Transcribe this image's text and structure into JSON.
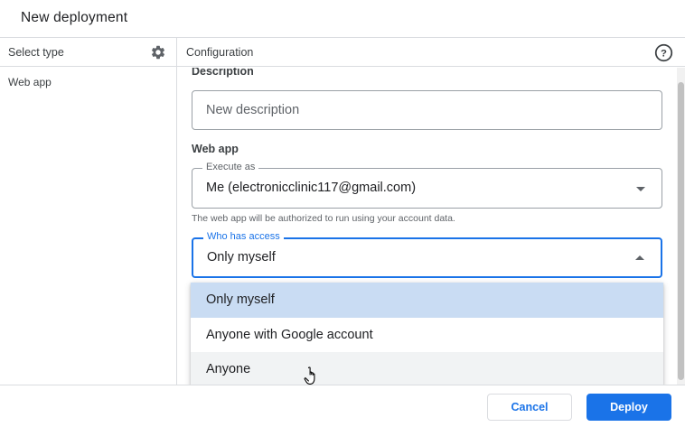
{
  "dialog": {
    "title": "New deployment"
  },
  "left": {
    "header_label": "Select type",
    "settings_icon": "gear-icon",
    "types": [
      "Web app"
    ]
  },
  "right": {
    "header_label": "Configuration",
    "help_icon": "help-circle-icon",
    "description": {
      "label": "Description",
      "placeholder": "New description",
      "value": ""
    },
    "web_app": {
      "section_label": "Web app",
      "execute_as": {
        "label": "Execute as",
        "value": "Me (electronicclinic117@gmail.com)"
      },
      "helper": "The web app will be authorized to run using your account data.",
      "who_has_access": {
        "label": "Who has access",
        "value": "Only myself",
        "options": [
          "Only myself",
          "Anyone with Google account",
          "Anyone"
        ],
        "selected_index": 0,
        "hovered_index": 2
      }
    }
  },
  "footer": {
    "cancel_label": "Cancel",
    "deploy_label": "Deploy"
  },
  "colors": {
    "accent": "#1a73e8",
    "selected_option": "#c9dcf3"
  }
}
